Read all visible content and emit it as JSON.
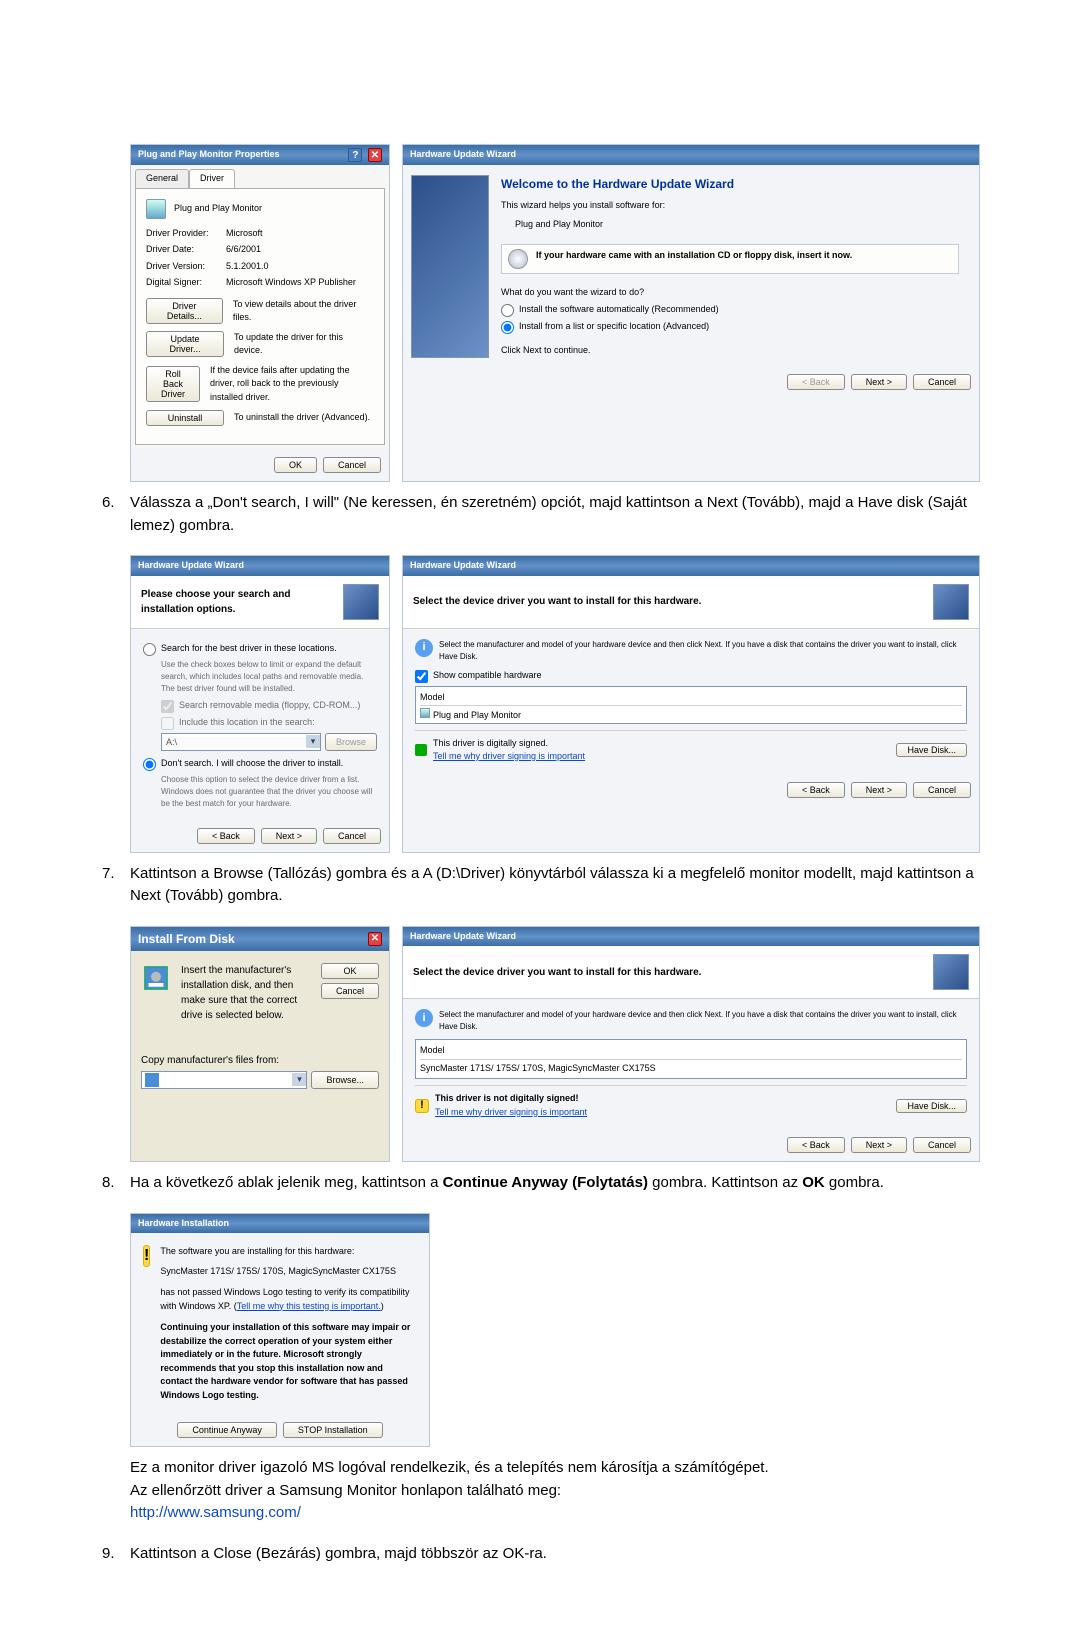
{
  "step6": {
    "text": "Válassza a „Don't search, I will\" (Ne keressen, én szeretném) opciót, majd kattintson a Next (Tovább), majd a Have disk (Saját lemez) gombra."
  },
  "step7": {
    "text": "Kattintson a Browse (Tallózás) gombra és a A (D:\\Driver) könyvtárból válassza ki a megfelelő monitor modellt, majd kattintson a Next (Tovább) gombra."
  },
  "step8": {
    "text1": "Ha a következő ablak jelenik meg, kattintson a ",
    "bold1": "Continue Anyway (Folytatás)",
    "text2": " gombra. Kattintson az ",
    "bold2": "OK",
    "text3": " gombra.",
    "after1": "Ez a monitor driver igazoló MS logóval rendelkezik, és a telepítés nem károsítja a számítógépet.",
    "after2": "Az ellenőrzött driver a Samsung Monitor honlapon található meg:",
    "url": "http://www.samsung.com/"
  },
  "step9": {
    "text": "Kattintson a Close (Bezárás) gombra, majd többször az OK-ra."
  },
  "props": {
    "title": "Plug and Play Monitor Properties",
    "tab_general": "General",
    "tab_driver": "Driver",
    "name": "Plug and Play Monitor",
    "lbl_provider": "Driver Provider:",
    "val_provider": "Microsoft",
    "lbl_date": "Driver Date:",
    "val_date": "6/6/2001",
    "lbl_version": "Driver Version:",
    "val_version": "5.1.2001.0",
    "lbl_signer": "Digital Signer:",
    "val_signer": "Microsoft Windows XP Publisher",
    "btn_details": "Driver Details...",
    "desc_details": "To view details about the driver files.",
    "btn_update": "Update Driver...",
    "desc_update": "To update the driver for this device.",
    "btn_rollback": "Roll Back Driver",
    "desc_rollback": "If the device fails after updating the driver, roll back to the previously installed driver.",
    "btn_uninstall": "Uninstall",
    "desc_uninstall": "To uninstall the driver (Advanced).",
    "ok": "OK",
    "cancel": "Cancel"
  },
  "wiz1": {
    "title": "Hardware Update Wizard",
    "welcome": "Welcome to the Hardware Update Wizard",
    "line1": "This wizard helps you install software for:",
    "line2": "Plug and Play Monitor",
    "cd_text": "If your hardware came with an installation CD or floppy disk, insert it now.",
    "q": "What do you want the wizard to do?",
    "r1": "Install the software automatically (Recommended)",
    "r2": "Install from a list or specific location (Advanced)",
    "next_hint": "Click Next to continue.",
    "back": "< Back",
    "next": "Next >",
    "cancel": "Cancel"
  },
  "wiz2": {
    "title": "Hardware Update Wizard",
    "head": "Please choose your search and installation options.",
    "r1": "Search for the best driver in these locations.",
    "r1desc": "Use the check boxes below to limit or expand the default search, which includes local paths and removable media. The best driver found will be installed.",
    "c1": "Search removable media (floppy, CD-ROM...)",
    "c2": "Include this location in the search:",
    "path": "A:\\",
    "browse": "Browse",
    "r2": "Don't search. I will choose the driver to install.",
    "r2desc": "Choose this option to select the device driver from a list. Windows does not guarantee that the driver you choose will be the best match for your hardware.",
    "back": "< Back",
    "next": "Next >",
    "cancel": "Cancel"
  },
  "wiz3": {
    "title": "Hardware Update Wizard",
    "head": "Select the device driver you want to install for this hardware.",
    "instr": "Select the manufacturer and model of your hardware device and then click Next. If you have a disk that contains the driver you want to install, click Have Disk.",
    "show": "Show compatible hardware",
    "model": "Model",
    "item": "Plug and Play Monitor",
    "sig": "This driver is digitally signed.",
    "why": "Tell me why driver signing is important",
    "havedisk": "Have Disk...",
    "back": "< Back",
    "next": "Next >",
    "cancel": "Cancel"
  },
  "installdisk": {
    "title": "Install From Disk",
    "instr": "Insert the manufacturer's installation disk, and then make sure that the correct drive is selected below.",
    "ok": "OK",
    "cancel": "Cancel",
    "copy": "Copy manufacturer's files from:",
    "path": "",
    "browse": "Browse..."
  },
  "wiz4": {
    "title": "Hardware Update Wizard",
    "head": "Select the device driver you want to install for this hardware.",
    "instr": "Select the manufacturer and model of your hardware device and then click Next. If you have a disk that contains the driver you want to install, click Have Disk.",
    "model": "Model",
    "item": "SyncMaster 171S/ 175S/ 170S, MagicSyncMaster CX175S",
    "sig": "This driver is not digitally signed!",
    "why": "Tell me why driver signing is important",
    "havedisk": "Have Disk...",
    "back": "< Back",
    "next": "Next >",
    "cancel": "Cancel"
  },
  "hwinstall": {
    "title": "Hardware Installation",
    "line1": "The software you are installing for this hardware:",
    "line2": "SyncMaster 171S/ 175S/ 170S, MagicSyncMaster CX175S",
    "line3": "has not passed Windows Logo testing to verify its compatibility with Windows XP. (",
    "link": "Tell me why this testing is important.",
    "close": ")",
    "warn": "Continuing your installation of this software may impair or destabilize the correct operation of your system either immediately or in the future. Microsoft strongly recommends that you stop this installation now and contact the hardware vendor for software that has passed Windows Logo testing.",
    "cont": "Continue Anyway",
    "stop": "STOP Installation"
  }
}
